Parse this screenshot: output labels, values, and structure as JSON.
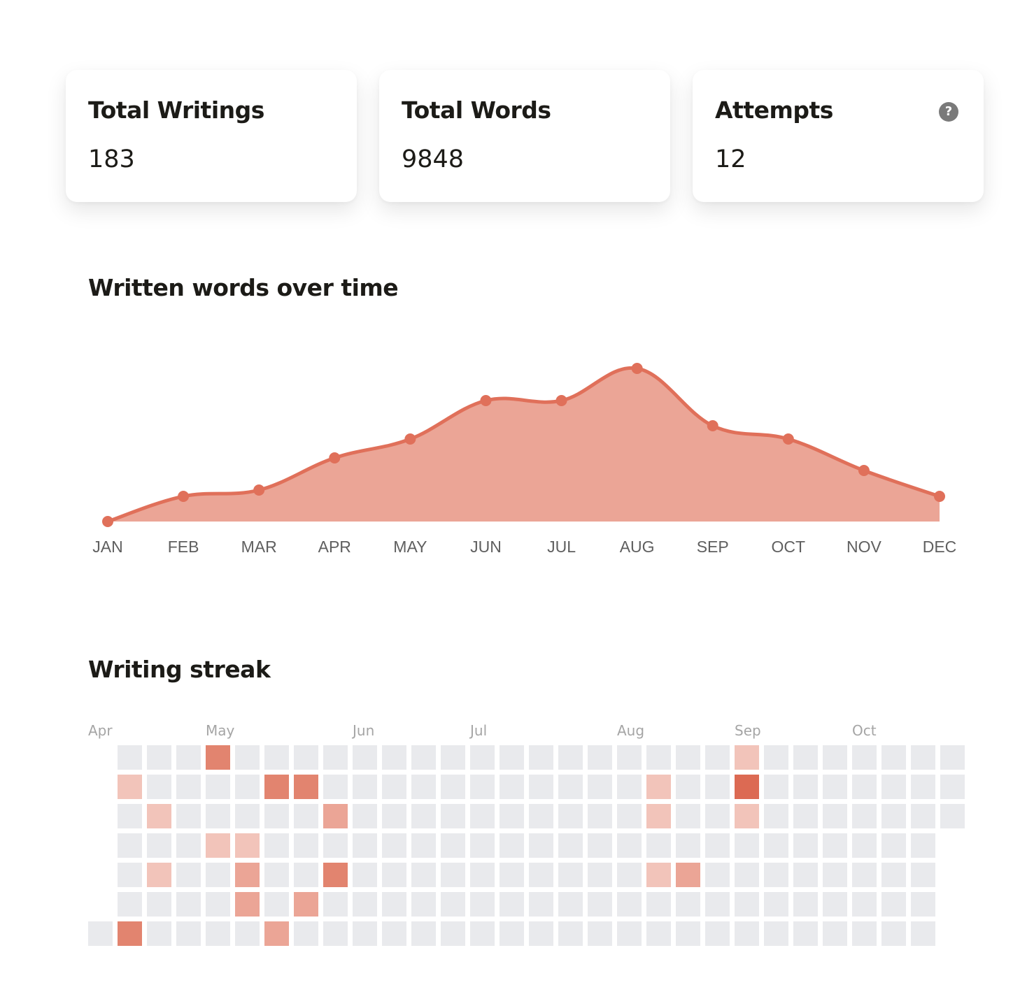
{
  "stats": [
    {
      "label": "Total Writings",
      "value": "183",
      "has_help": false
    },
    {
      "label": "Total Words",
      "value": "9848",
      "has_help": false
    },
    {
      "label": "Attempts",
      "value": "12",
      "has_help": true,
      "help_icon": "question-circle-icon",
      "help_glyph": "?"
    }
  ],
  "sections": {
    "words_title": "Written words over time",
    "streak_title": "Writing streak"
  },
  "colors": {
    "accent_line": "#e0705a",
    "accent_fill": "#eba596",
    "heat_empty": "#e9eaed",
    "heat_levels": [
      "#e9eaed",
      "#f2c4ba",
      "#eba596",
      "#e2846f",
      "#dc6a53"
    ]
  },
  "chart_data": [
    {
      "type": "area",
      "title": "Written words over time",
      "xlabel": "",
      "ylabel": "",
      "categories": [
        "JAN",
        "FEB",
        "MAR",
        "APR",
        "MAY",
        "JUN",
        "JUL",
        "AUG",
        "SEP",
        "OCT",
        "NOV",
        "DEC"
      ],
      "values": [
        0,
        36,
        45,
        91,
        118,
        173,
        173,
        219,
        137,
        118,
        73,
        36
      ],
      "ylim": [
        0,
        219
      ],
      "grid": false,
      "legend": "none",
      "y_axis_visible": false,
      "smooth": true,
      "markers": true
    },
    {
      "type": "heatmap",
      "title": "Writing streak",
      "month_labels": [
        {
          "label": "Apr",
          "week": 0
        },
        {
          "label": "May",
          "week": 4
        },
        {
          "label": "Jun",
          "week": 9
        },
        {
          "label": "Jul",
          "week": 13
        },
        {
          "label": "Aug",
          "week": 18
        },
        {
          "label": "Sep",
          "week": 22
        },
        {
          "label": "Oct",
          "week": 26
        }
      ],
      "weeks": 30,
      "days_per_week": 7,
      "first_week_start_day": 6,
      "last_week_days": 3,
      "max_level": 4,
      "active_cells": [
        {
          "week": 1,
          "day": 1,
          "level": 1
        },
        {
          "week": 1,
          "day": 6,
          "level": 3
        },
        {
          "week": 2,
          "day": 2,
          "level": 1
        },
        {
          "week": 2,
          "day": 4,
          "level": 1
        },
        {
          "week": 4,
          "day": 0,
          "level": 3
        },
        {
          "week": 4,
          "day": 3,
          "level": 1
        },
        {
          "week": 5,
          "day": 3,
          "level": 1
        },
        {
          "week": 5,
          "day": 4,
          "level": 2
        },
        {
          "week": 5,
          "day": 5,
          "level": 2
        },
        {
          "week": 6,
          "day": 1,
          "level": 3
        },
        {
          "week": 6,
          "day": 6,
          "level": 2
        },
        {
          "week": 7,
          "day": 1,
          "level": 3
        },
        {
          "week": 7,
          "day": 5,
          "level": 2
        },
        {
          "week": 8,
          "day": 2,
          "level": 2
        },
        {
          "week": 8,
          "day": 4,
          "level": 3
        },
        {
          "week": 19,
          "day": 1,
          "level": 1
        },
        {
          "week": 19,
          "day": 2,
          "level": 1
        },
        {
          "week": 19,
          "day": 4,
          "level": 1
        },
        {
          "week": 20,
          "day": 4,
          "level": 2
        },
        {
          "week": 22,
          "day": 0,
          "level": 1
        },
        {
          "week": 22,
          "day": 1,
          "level": 4
        },
        {
          "week": 22,
          "day": 2,
          "level": 1
        }
      ]
    }
  ]
}
